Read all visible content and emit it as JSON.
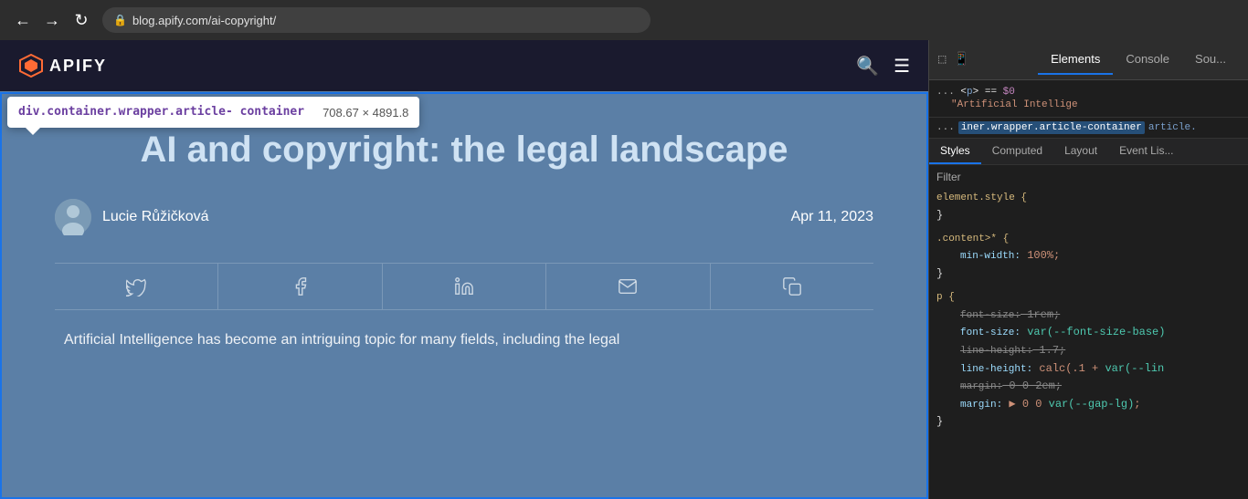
{
  "browser": {
    "back_btn": "←",
    "forward_btn": "→",
    "refresh_btn": "↻",
    "url": "blog.apify.com/ai-copyright/",
    "lock_icon": "🔒"
  },
  "site": {
    "logo_text": "APIFY",
    "nav_search_icon": "search",
    "nav_menu_icon": "menu"
  },
  "tooltip": {
    "element_name": "div.container.wrapper.article-\ncontainer",
    "dimensions": "708.67 × 4891.8",
    "arrow": true
  },
  "article": {
    "title": "AI and copyright: the legal landscape",
    "author_name": "Lucie Růžičková",
    "date": "Apr 11, 2023",
    "excerpt": "Artificial Intelligence has become an intriguing topic for many fields, including the legal"
  },
  "social_icons": [
    {
      "icon": "twitter",
      "unicode": "𝕏"
    },
    {
      "icon": "facebook",
      "unicode": "f"
    },
    {
      "icon": "linkedin",
      "unicode": "in"
    },
    {
      "icon": "email",
      "unicode": "✉"
    },
    {
      "icon": "copy",
      "unicode": "⧉"
    }
  ],
  "devtools": {
    "toolbar_icons": [
      "cursor-inspect",
      "device-emulation",
      "dots-menu"
    ],
    "tabs": [
      "Elements",
      "Console",
      "Sou..."
    ],
    "active_tab": "Elements",
    "dom": {
      "line1": "... <p> == $0",
      "line2": "\"Artificial Intellige",
      "breadcrumb_dots": "...",
      "breadcrumb_node": "iner.wrapper.article-container",
      "breadcrumb_next": "article."
    },
    "styles_tabs": [
      "Styles",
      "Computed",
      "Layout",
      "Event Lis..."
    ],
    "active_styles_tab": "Styles",
    "filter_label": "Filter",
    "css_rules": [
      {
        "selector": "element.style {",
        "close": "}",
        "properties": []
      },
      {
        "selector": ".content>* {",
        "close": "}",
        "properties": [
          {
            "name": "min-width:",
            "value": "100%;",
            "strikethrough": false
          }
        ]
      },
      {
        "selector": "p {",
        "close": "}",
        "properties": [
          {
            "name": "font-size:",
            "value": "1rem;",
            "strikethrough": true
          },
          {
            "name": "font-size:",
            "value": "var(--font-size-base)",
            "strikethrough": false
          },
          {
            "name": "line-height:",
            "value": "1.7;",
            "strikethrough": true
          },
          {
            "name": "line-height:",
            "value": "calc(.1 + var(--lin",
            "strikethrough": false
          },
          {
            "name": "margin:",
            "value": "0 0 2em;",
            "strikethrough": true
          },
          {
            "name": "margin:",
            "value": "0 0 var(--gap-lg);",
            "strikethrough": false
          }
        ]
      }
    ]
  }
}
